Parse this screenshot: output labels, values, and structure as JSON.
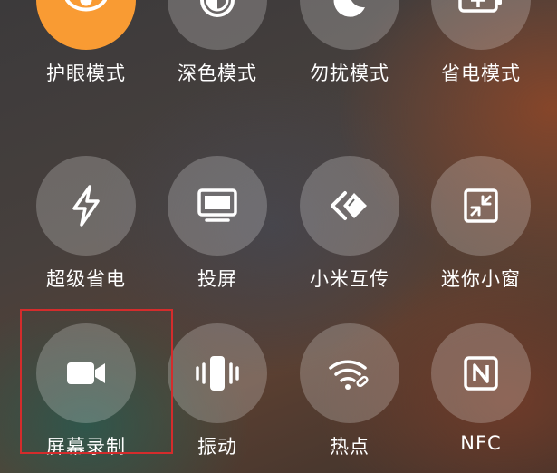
{
  "colors": {
    "active_tile": "#f99b33",
    "inactive_tile": "rgba(255,255,255,0.22)",
    "highlight": "#d42c2c",
    "label": "#ffffff"
  },
  "tiles": [
    {
      "label": "护眼模式",
      "icon": "eye-icon",
      "active": true
    },
    {
      "label": "深色模式",
      "icon": "dark-mode-icon",
      "active": false
    },
    {
      "label": "勿扰模式",
      "icon": "moon-icon",
      "active": false
    },
    {
      "label": "省电模式",
      "icon": "battery-saver-icon",
      "active": false
    },
    {
      "label": "超级省电",
      "icon": "lightning-icon",
      "active": false
    },
    {
      "label": "投屏",
      "icon": "monitor-icon",
      "active": false
    },
    {
      "label": "小米互传",
      "icon": "mi-share-icon",
      "active": false
    },
    {
      "label": "迷你小窗",
      "icon": "mini-window-icon",
      "active": false
    },
    {
      "label": "屏幕录制",
      "icon": "video-camera-icon",
      "active": false,
      "highlighted": true
    },
    {
      "label": "振动",
      "icon": "vibrate-icon",
      "active": false
    },
    {
      "label": "热点",
      "icon": "hotspot-icon",
      "active": false
    },
    {
      "label": "NFC",
      "icon": "nfc-icon",
      "active": false
    }
  ]
}
